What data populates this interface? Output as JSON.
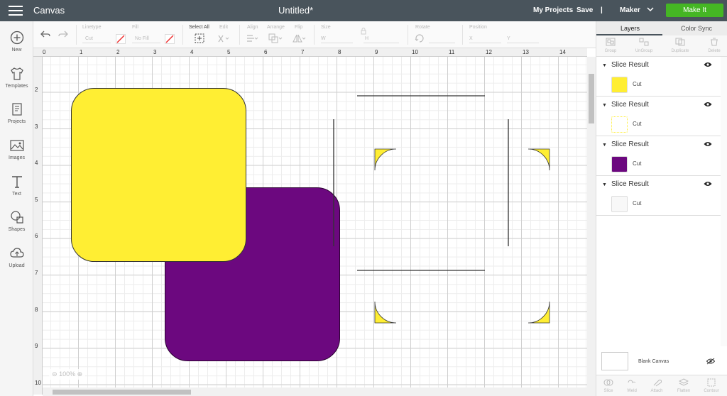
{
  "topbar": {
    "app_title": "Canvas",
    "doc_title": "Untitled*",
    "my_projects": "My Projects",
    "save": "Save",
    "divider": "|",
    "machine": "Maker",
    "make_it": "Make It"
  },
  "toolbar": {
    "linetype_label": "Linetype",
    "linetype_value": "Cut",
    "fill_label": "Fill",
    "fill_value": "No Fill",
    "select_all": "Select All",
    "edit": "Edit",
    "align": "Align",
    "arrange": "Arrange",
    "flip": "Flip",
    "size": "Size",
    "size_w": "W",
    "size_h": "H",
    "rotate": "Rotate",
    "position": "Position",
    "pos_x": "X",
    "pos_y": "Y"
  },
  "sidebar": {
    "items": [
      {
        "label": "New",
        "icon": "plus-circle-icon"
      },
      {
        "label": "Templates",
        "icon": "tshirt-icon"
      },
      {
        "label": "Projects",
        "icon": "projects-icon"
      },
      {
        "label": "Images",
        "icon": "image-icon"
      },
      {
        "label": "Text",
        "icon": "text-icon"
      },
      {
        "label": "Shapes",
        "icon": "shapes-icon"
      },
      {
        "label": "Upload",
        "icon": "upload-cloud-icon"
      }
    ]
  },
  "ruler": {
    "top": [
      "0",
      "1",
      "2",
      "3",
      "4",
      "5",
      "6",
      "7",
      "8",
      "9",
      "10",
      "11",
      "12",
      "13",
      "14"
    ],
    "left": [
      "2",
      "3",
      "4",
      "5",
      "6",
      "7",
      "8",
      "9",
      "10"
    ]
  },
  "canvas": {
    "zoom": "100%"
  },
  "panel": {
    "tabs": [
      "Layers",
      "Color Sync"
    ],
    "tools": [
      "Group",
      "UnGroup",
      "Duplicate",
      "Delete"
    ],
    "layers": [
      {
        "title": "Slice Result",
        "op": "Cut",
        "swatch": "#ffee33"
      },
      {
        "title": "Slice Result",
        "op": "Cut",
        "swatch": "#ffffff"
      },
      {
        "title": "Slice Result",
        "op": "Cut",
        "swatch": "#6c087f"
      },
      {
        "title": "Slice Result",
        "op": "Cut",
        "swatch": "#f8f8f8"
      }
    ],
    "blank_canvas": "Blank Canvas",
    "bottom_tools": [
      "Slice",
      "Weld",
      "Attach",
      "Flatten",
      "Contour"
    ]
  },
  "colors": {
    "topbar": "#49545c",
    "make_it": "#45b624",
    "yellow": "#ffee33",
    "purple": "#6c087f"
  }
}
